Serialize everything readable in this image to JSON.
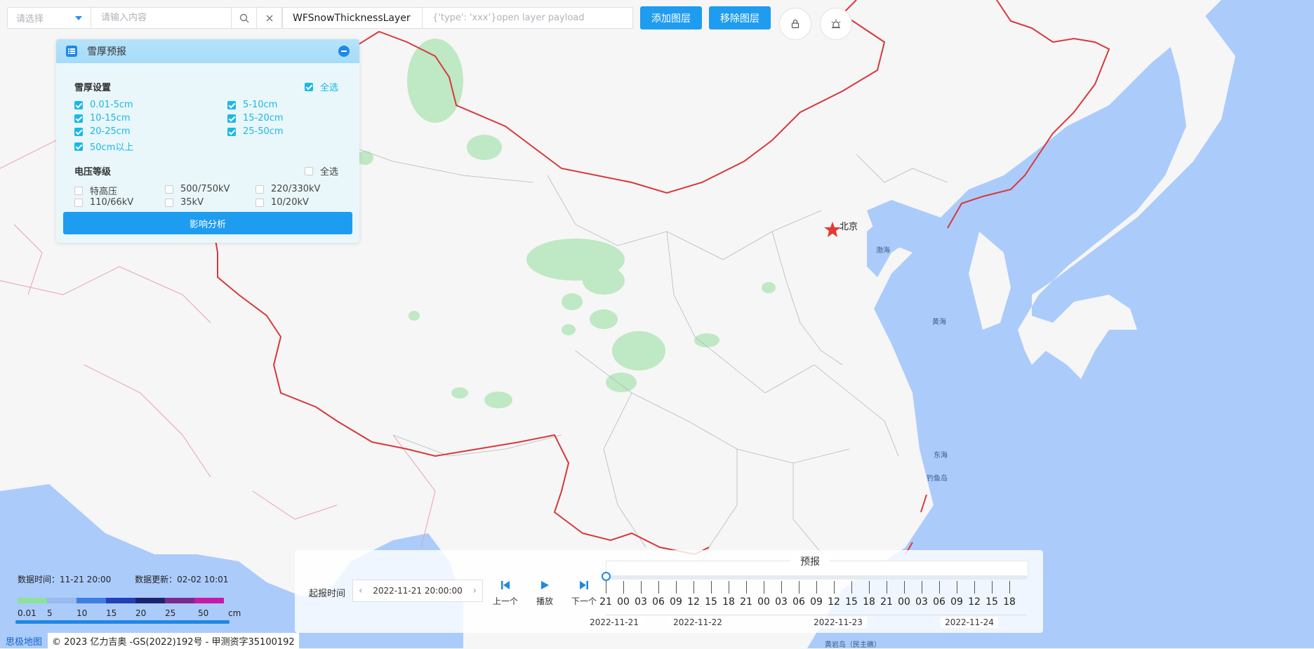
{
  "toolbar": {
    "select_placeholder": "请选择",
    "search_placeholder": "请输入内容",
    "layer_value": "WFSnowThicknessLayer",
    "payload_placeholder": "{'type': 'xxx'}open layer payload",
    "add_layer": "添加图层",
    "remove_layer": "移除图层"
  },
  "map": {
    "city": "北京",
    "labels": {
      "bohai": "渤海",
      "huanghai": "黄海",
      "donghai": "东海",
      "diaoyudao": "钓鱼岛",
      "huangyan": "黄岩岛（民主礁）"
    },
    "colors": {
      "land": "#f6f6f6",
      "sea": "#abcbfb",
      "border": "#d9373a",
      "snow": "#bfe8c4"
    }
  },
  "panel": {
    "title": "雪厚预报",
    "snow": {
      "title": "雪厚设置",
      "select_all": "全选",
      "select_all_checked": true,
      "items": [
        {
          "label": "0.01-5cm",
          "checked": true
        },
        {
          "label": "5-10cm",
          "checked": true
        },
        {
          "label": "10-15cm",
          "checked": true
        },
        {
          "label": "15-20cm",
          "checked": true
        },
        {
          "label": "20-25cm",
          "checked": true
        },
        {
          "label": "25-50cm",
          "checked": true
        },
        {
          "label": "50cm以上",
          "checked": true
        }
      ]
    },
    "voltage": {
      "title": "电压等级",
      "select_all": "全选",
      "select_all_checked": false,
      "items": [
        {
          "label": "特高压",
          "checked": false
        },
        {
          "label": "500/750kV",
          "checked": false
        },
        {
          "label": "220/330kV",
          "checked": false
        },
        {
          "label": "110/66kV",
          "checked": false
        },
        {
          "label": "35kV",
          "checked": false
        },
        {
          "label": "10/20kV",
          "checked": false
        }
      ]
    },
    "analyze": "影响分析"
  },
  "legend": {
    "data_time": "数据时间：11-21 20:00",
    "data_update": "数据更新：02-02 10:01",
    "colors": [
      "#8fe09a",
      "#9ab9f0",
      "#3e7fe0",
      "#2340b8",
      "#1a2570",
      "#7a2a8f",
      "#c61aa8"
    ],
    "ticks": [
      "0.01",
      "5",
      "10",
      "15",
      "20",
      "25",
      "50"
    ],
    "unit": "cm"
  },
  "credits": {
    "logo": "思极地图",
    "copyright": "© 2023 亿力吉奥 -GS(2022)192号 - 甲测资字35100192"
  },
  "timeline": {
    "start_label": "起报时间",
    "start_time": "2022-11-21 20:00:00",
    "prev": "上一个",
    "play": "播放",
    "next": "下一个",
    "forecast": "预报",
    "hours": [
      "21",
      "00",
      "03",
      "06",
      "09",
      "12",
      "15",
      "18",
      "21",
      "00",
      "03",
      "06",
      "09",
      "12",
      "15",
      "18",
      "21",
      "00",
      "03",
      "06",
      "09",
      "12",
      "15",
      "18"
    ],
    "days": [
      "2022-11-21",
      "2022-11-22",
      "2022-11-23",
      "2022-11-24"
    ],
    "current_index": 0
  }
}
